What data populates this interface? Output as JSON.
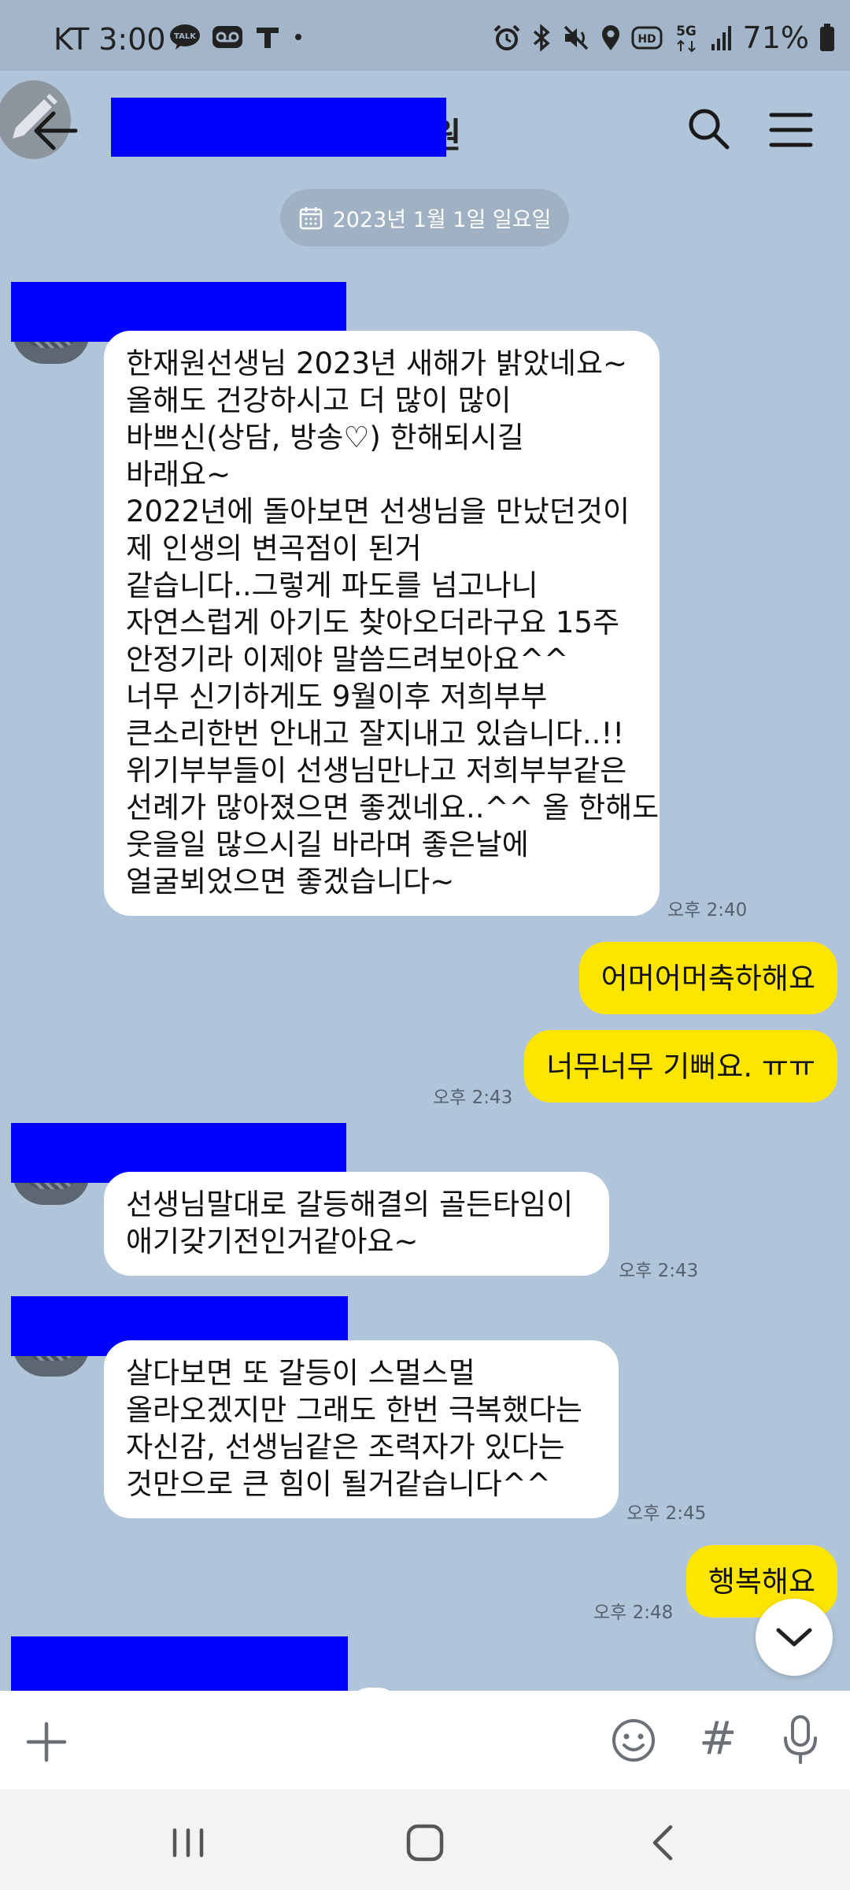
{
  "status_bar": {
    "carrier_time": "KT 3:00",
    "talk_badge": "TALK",
    "network": "5G",
    "hd_badge": "HD",
    "battery": "71%",
    "icons": [
      "talk-bubble-icon",
      "voicemail-icon",
      "t-icon",
      "dot-icon",
      "alarm-icon",
      "bluetooth-icon",
      "mute-icon",
      "location-icon",
      "hd-icon",
      "5g-icon",
      "signal-icon",
      "battery-icon"
    ]
  },
  "header": {
    "title_visible_fragment": "원",
    "icons": [
      "edit-icon",
      "back-arrow-icon",
      "search-icon",
      "menu-icon"
    ]
  },
  "date_divider": "2023년 1월 1일 일요일",
  "messages": {
    "m1": {
      "lines": [
        "한재원선생님 2023년 새해가 밝았네요~",
        "올해도 건강하시고 더 많이 많이",
        "바쁘신(상담, 방송♡) 한해되시길",
        "바래요~",
        "2022년에 돌아보면 선생님을 만났던것이",
        "제 인생의 변곡점이 된거",
        "같습니다..그렇게 파도를 넘고나니",
        "자연스럽게 아기도 찾아오더라구요 15주",
        "안정기라 이제야 말씀드려보아요^^",
        "너무 신기하게도 9월이후 저희부부",
        "큰소리한번 안내고 잘지내고 있습니다..!!",
        "위기부부들이 선생님만나고 저희부부같은",
        "선례가 많아졌으면 좋겠네요..^^ 올 한해도",
        "웃을일 많으시길 바라며 좋은날에",
        "얼굴뵈었으면 좋겠습니다~"
      ],
      "time": "오후 2:40"
    },
    "m2": {
      "text": "어머어머축하해요"
    },
    "m3": {
      "text": "너무너무 기뻐요. ㅠㅠ",
      "time": "오후 2:43"
    },
    "m4": {
      "lines": [
        "선생님말대로 갈등해결의 골든타임이",
        "애기갖기전인거같아요~"
      ],
      "time": "오후 2:43"
    },
    "m5": {
      "lines": [
        "살다보면 또 갈등이 스멀스멀",
        "올라오겠지만 그래도 한번 극복했다는",
        "자신감, 선생님같은 조력자가 있다는",
        "것만으로 큰 힘이 될거같습니다^^"
      ],
      "time": "오후 2:45"
    },
    "m6": {
      "text": "행복해요",
      "time": "오후 2:48"
    }
  },
  "input_bar": {
    "hash_label": "#",
    "icons": [
      "plus-icon",
      "emoji-icon",
      "hashtag-icon",
      "mic-icon"
    ]
  },
  "nav_bar": {
    "icons": [
      "recents-icon",
      "home-icon",
      "back-icon"
    ]
  },
  "colors": {
    "chat_background": "#b1c5da",
    "sent_bubble": "#fee500",
    "received_bubble": "#ffffff",
    "redaction": "#0000ff"
  }
}
